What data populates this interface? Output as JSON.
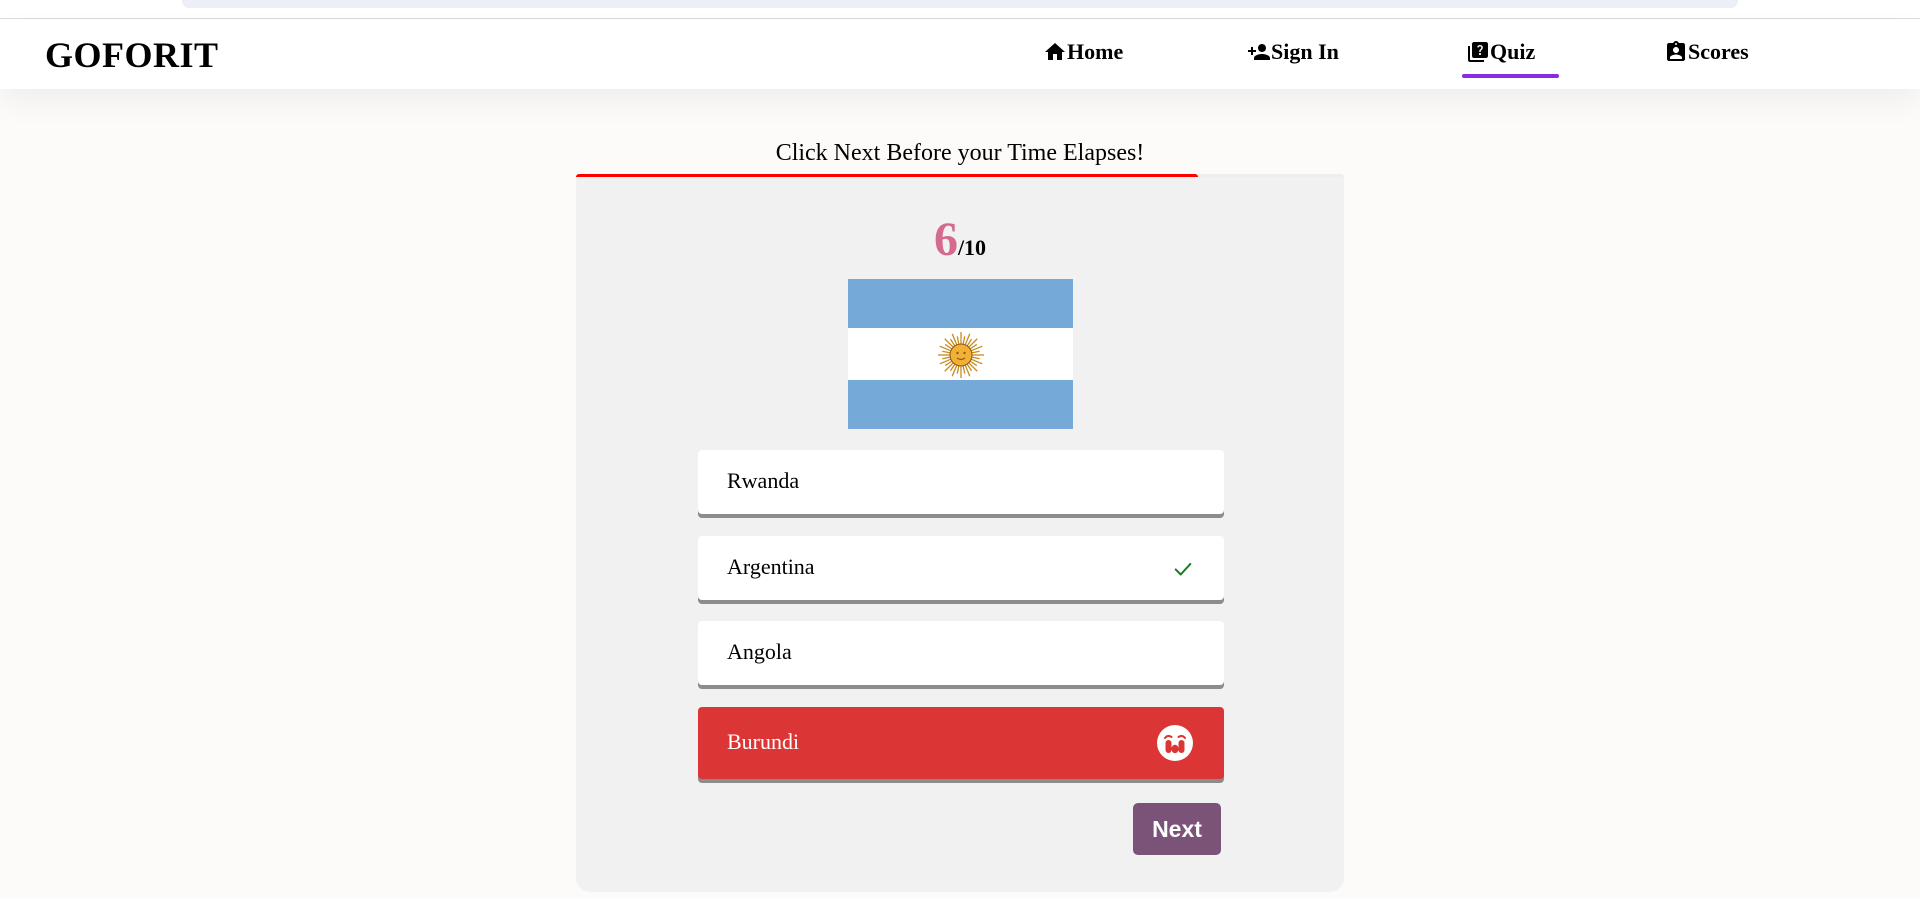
{
  "brand": "GOFORIT",
  "nav": {
    "home": {
      "label": "Home",
      "icon": "home-icon"
    },
    "signin": {
      "label": "Sign In",
      "icon": "person-add-icon"
    },
    "quiz": {
      "label": "Quiz",
      "icon": "quiz-book-icon",
      "active": true
    },
    "scores": {
      "label": "Scores",
      "icon": "clipboard-person-icon"
    }
  },
  "timer": {
    "caption": "Click Next Before your Time Elapses!",
    "remaining_fraction": 0.81
  },
  "quiz": {
    "current": "6",
    "total": "/10",
    "flag": "Argentina flag",
    "options": [
      {
        "label": "Rwanda",
        "state": "neutral"
      },
      {
        "label": "Argentina",
        "state": "correct",
        "icon": "check-icon"
      },
      {
        "label": "Angola",
        "state": "neutral"
      },
      {
        "label": "Burundi",
        "state": "wrong",
        "icon": "sad-face-icon"
      }
    ],
    "next_label": "Next"
  },
  "colors": {
    "accent_underline": "#8a2be2",
    "timer_bar": "#ff0000",
    "counter": "#d66a8c",
    "wrong": "#dc3535",
    "correct": "#1a7f1a",
    "next_button": "#7b5379",
    "flag_blue": "#74a9d8",
    "flag_sun": "#f2b134"
  }
}
